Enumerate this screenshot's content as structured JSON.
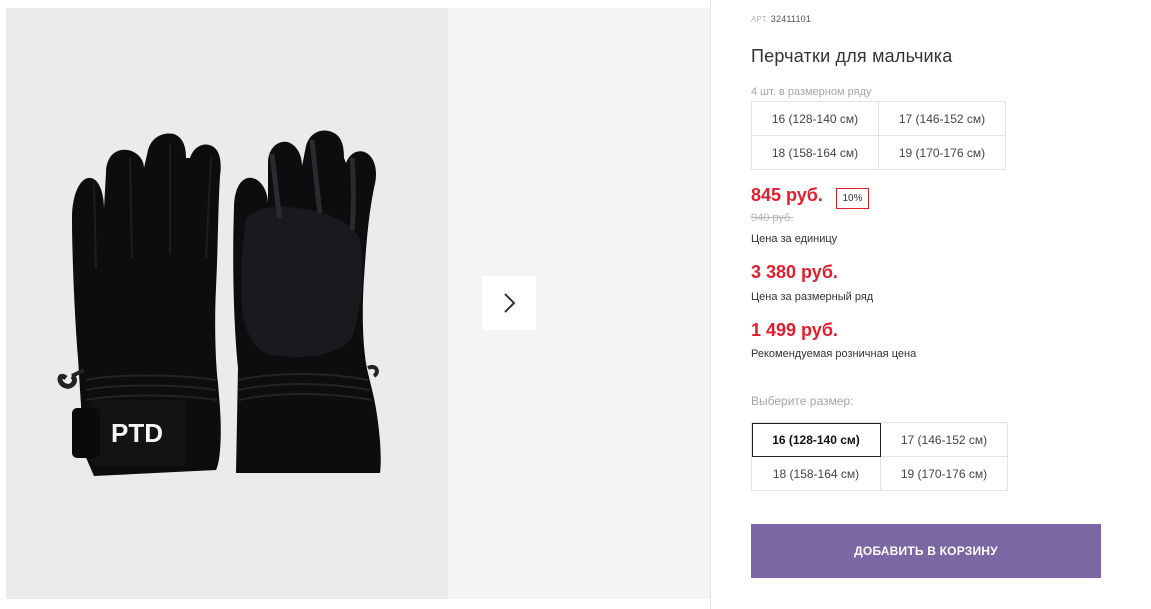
{
  "product": {
    "sku_label": "АРТ.",
    "sku": "32411101",
    "title": "Перчатки для мальчика",
    "brand_print": "PTD"
  },
  "gallery": {
    "next_icon": "chevron-right-icon"
  },
  "pack": {
    "caption": "4 шт. в размерном ряду",
    "sizes": [
      "16 (128-140 см)",
      "17 (146-152 см)",
      "18 (158-164 см)",
      "19 (170-176 см)"
    ]
  },
  "prices": {
    "unit_price": "845 руб.",
    "discount": "10%",
    "old_price": "940 руб.",
    "unit_caption": "Цена за единицу",
    "pack_price": "3 380 руб.",
    "pack_caption": "Цена за размерный ряд",
    "retail_price": "1 499 руб.",
    "retail_caption": "Рекомендуемая розничная цена"
  },
  "size_select": {
    "caption": "Выберите размер:",
    "options": [
      "16 (128-140 см)",
      "17 (146-152 см)",
      "18 (158-164 см)",
      "19 (170-176 см)"
    ],
    "selected": "16 (128-140 см)"
  },
  "cart": {
    "button_label": "Добавить в корзину"
  },
  "colors": {
    "price_red": "#e21e2d",
    "button_purple": "#7b67a3",
    "main_photo_bg": "#ebebeb",
    "second_photo_bg": "#f4f4f4"
  }
}
